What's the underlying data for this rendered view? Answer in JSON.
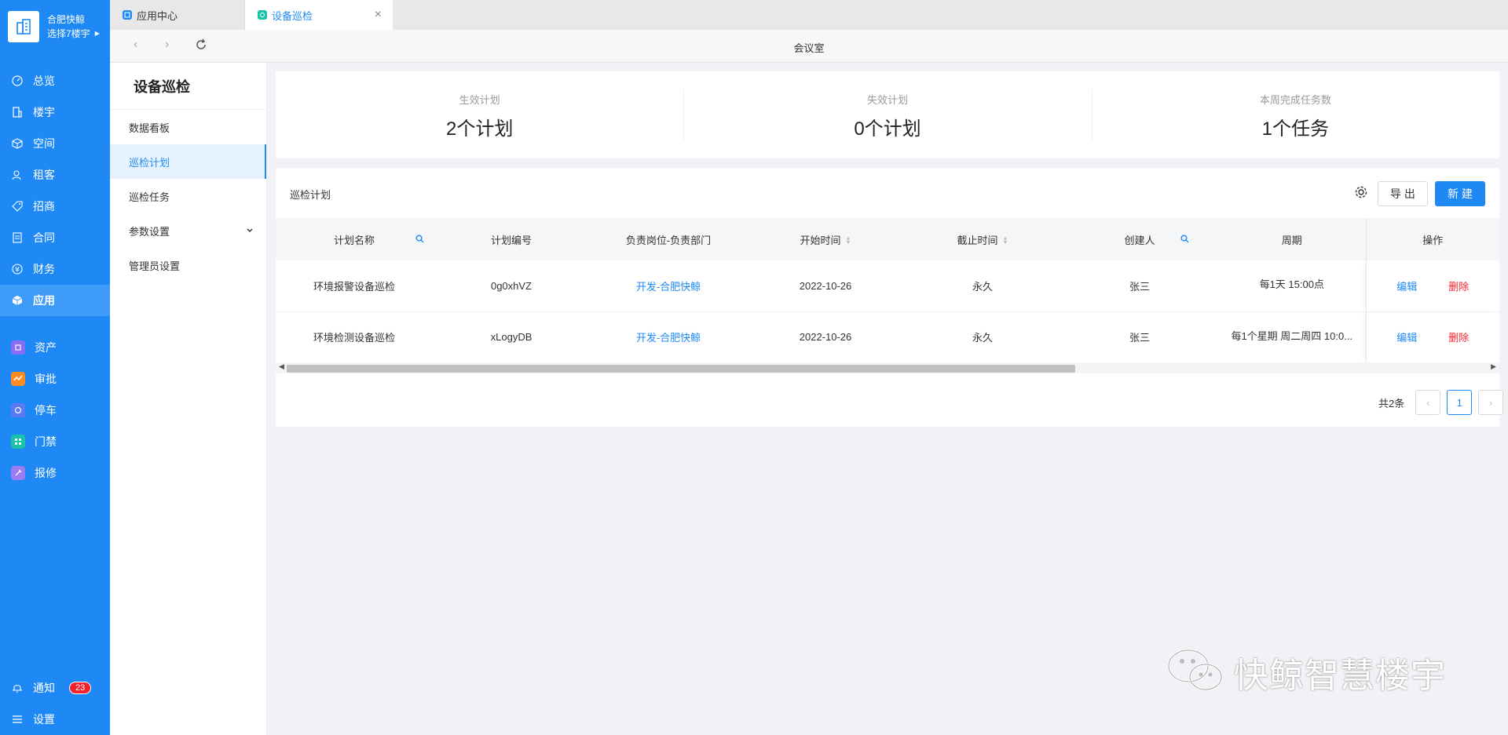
{
  "brand": {
    "name": "合肥快鲸",
    "floor_selector": "选择7楼宇"
  },
  "nav": {
    "items": [
      {
        "label": "总览"
      },
      {
        "label": "楼宇"
      },
      {
        "label": "空间"
      },
      {
        "label": "租客"
      },
      {
        "label": "招商"
      },
      {
        "label": "合同"
      },
      {
        "label": "财务"
      },
      {
        "label": "应用"
      }
    ],
    "apps": [
      {
        "label": "资产",
        "color": "#8b6cf7"
      },
      {
        "label": "审批",
        "color": "#ff8a1f"
      },
      {
        "label": "停车",
        "color": "#5b7bf5"
      },
      {
        "label": "门禁",
        "color": "#18c3a7"
      },
      {
        "label": "报修",
        "color": "#9b7cf5"
      }
    ],
    "notifications": {
      "label": "通知",
      "count": "23"
    },
    "settings": {
      "label": "设置"
    }
  },
  "tabs": [
    {
      "label": "应用中心"
    },
    {
      "label": "设备巡检"
    }
  ],
  "address_bar": {
    "title": "会议室"
  },
  "sub_sidebar": {
    "title": "设备巡检",
    "items": [
      {
        "label": "数据看板"
      },
      {
        "label": "巡检计划"
      },
      {
        "label": "巡检任务"
      },
      {
        "label": "参数设置"
      },
      {
        "label": "管理员设置"
      }
    ]
  },
  "stats": [
    {
      "label": "生效计划",
      "value": "2个计划"
    },
    {
      "label": "失效计划",
      "value": "0个计划"
    },
    {
      "label": "本周完成任务数",
      "value": "1个任务"
    }
  ],
  "panel": {
    "title": "巡检计划",
    "export_label": "导 出",
    "new_label": "新 建"
  },
  "table": {
    "columns": [
      "计划名称",
      "计划编号",
      "负责岗位-负责部门",
      "开始时间",
      "截止时间",
      "创建人",
      "周期",
      "操作"
    ],
    "rows": [
      {
        "name": "环境报警设备巡检",
        "code": "0g0xhVZ",
        "dept": "开发-合肥快鲸",
        "start": "2022-10-26",
        "end": "永久",
        "creator": "张三",
        "period": "每1天 15:00点",
        "edit": "编辑",
        "delete": "删除"
      },
      {
        "name": "环境检测设备巡检",
        "code": "xLogyDB",
        "dept": "开发-合肥快鲸",
        "start": "2022-10-26",
        "end": "永久",
        "creator": "张三",
        "period": "每1个星期 周二周四 10:0...",
        "edit": "编辑",
        "delete": "删除"
      }
    ]
  },
  "pagination": {
    "total": "共2条",
    "current": "1"
  },
  "watermark": {
    "text": "快鲸智慧楼宇"
  },
  "colors": {
    "primary": "#1e88f5",
    "danger": "#f5222d",
    "sidebar": "#1e88f5"
  }
}
